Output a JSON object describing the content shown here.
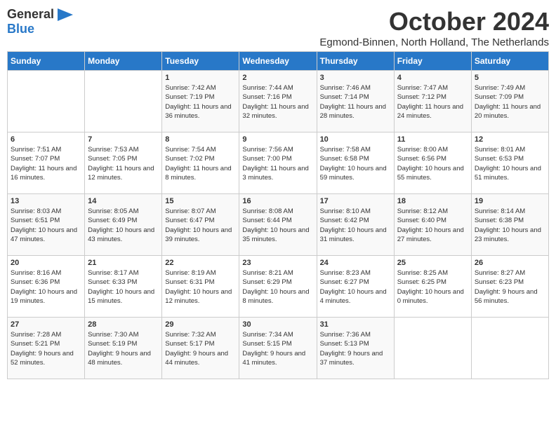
{
  "header": {
    "logo_general": "General",
    "logo_blue": "Blue",
    "month_title": "October 2024",
    "subtitle": "Egmond-Binnen, North Holland, The Netherlands"
  },
  "days_of_week": [
    "Sunday",
    "Monday",
    "Tuesday",
    "Wednesday",
    "Thursday",
    "Friday",
    "Saturday"
  ],
  "weeks": [
    [
      {
        "day": "",
        "sunrise": "",
        "sunset": "",
        "daylight": ""
      },
      {
        "day": "",
        "sunrise": "",
        "sunset": "",
        "daylight": ""
      },
      {
        "day": "1",
        "sunrise": "Sunrise: 7:42 AM",
        "sunset": "Sunset: 7:19 PM",
        "daylight": "Daylight: 11 hours and 36 minutes."
      },
      {
        "day": "2",
        "sunrise": "Sunrise: 7:44 AM",
        "sunset": "Sunset: 7:16 PM",
        "daylight": "Daylight: 11 hours and 32 minutes."
      },
      {
        "day": "3",
        "sunrise": "Sunrise: 7:46 AM",
        "sunset": "Sunset: 7:14 PM",
        "daylight": "Daylight: 11 hours and 28 minutes."
      },
      {
        "day": "4",
        "sunrise": "Sunrise: 7:47 AM",
        "sunset": "Sunset: 7:12 PM",
        "daylight": "Daylight: 11 hours and 24 minutes."
      },
      {
        "day": "5",
        "sunrise": "Sunrise: 7:49 AM",
        "sunset": "Sunset: 7:09 PM",
        "daylight": "Daylight: 11 hours and 20 minutes."
      }
    ],
    [
      {
        "day": "6",
        "sunrise": "Sunrise: 7:51 AM",
        "sunset": "Sunset: 7:07 PM",
        "daylight": "Daylight: 11 hours and 16 minutes."
      },
      {
        "day": "7",
        "sunrise": "Sunrise: 7:53 AM",
        "sunset": "Sunset: 7:05 PM",
        "daylight": "Daylight: 11 hours and 12 minutes."
      },
      {
        "day": "8",
        "sunrise": "Sunrise: 7:54 AM",
        "sunset": "Sunset: 7:02 PM",
        "daylight": "Daylight: 11 hours and 8 minutes."
      },
      {
        "day": "9",
        "sunrise": "Sunrise: 7:56 AM",
        "sunset": "Sunset: 7:00 PM",
        "daylight": "Daylight: 11 hours and 3 minutes."
      },
      {
        "day": "10",
        "sunrise": "Sunrise: 7:58 AM",
        "sunset": "Sunset: 6:58 PM",
        "daylight": "Daylight: 10 hours and 59 minutes."
      },
      {
        "day": "11",
        "sunrise": "Sunrise: 8:00 AM",
        "sunset": "Sunset: 6:56 PM",
        "daylight": "Daylight: 10 hours and 55 minutes."
      },
      {
        "day": "12",
        "sunrise": "Sunrise: 8:01 AM",
        "sunset": "Sunset: 6:53 PM",
        "daylight": "Daylight: 10 hours and 51 minutes."
      }
    ],
    [
      {
        "day": "13",
        "sunrise": "Sunrise: 8:03 AM",
        "sunset": "Sunset: 6:51 PM",
        "daylight": "Daylight: 10 hours and 47 minutes."
      },
      {
        "day": "14",
        "sunrise": "Sunrise: 8:05 AM",
        "sunset": "Sunset: 6:49 PM",
        "daylight": "Daylight: 10 hours and 43 minutes."
      },
      {
        "day": "15",
        "sunrise": "Sunrise: 8:07 AM",
        "sunset": "Sunset: 6:47 PM",
        "daylight": "Daylight: 10 hours and 39 minutes."
      },
      {
        "day": "16",
        "sunrise": "Sunrise: 8:08 AM",
        "sunset": "Sunset: 6:44 PM",
        "daylight": "Daylight: 10 hours and 35 minutes."
      },
      {
        "day": "17",
        "sunrise": "Sunrise: 8:10 AM",
        "sunset": "Sunset: 6:42 PM",
        "daylight": "Daylight: 10 hours and 31 minutes."
      },
      {
        "day": "18",
        "sunrise": "Sunrise: 8:12 AM",
        "sunset": "Sunset: 6:40 PM",
        "daylight": "Daylight: 10 hours and 27 minutes."
      },
      {
        "day": "19",
        "sunrise": "Sunrise: 8:14 AM",
        "sunset": "Sunset: 6:38 PM",
        "daylight": "Daylight: 10 hours and 23 minutes."
      }
    ],
    [
      {
        "day": "20",
        "sunrise": "Sunrise: 8:16 AM",
        "sunset": "Sunset: 6:36 PM",
        "daylight": "Daylight: 10 hours and 19 minutes."
      },
      {
        "day": "21",
        "sunrise": "Sunrise: 8:17 AM",
        "sunset": "Sunset: 6:33 PM",
        "daylight": "Daylight: 10 hours and 15 minutes."
      },
      {
        "day": "22",
        "sunrise": "Sunrise: 8:19 AM",
        "sunset": "Sunset: 6:31 PM",
        "daylight": "Daylight: 10 hours and 12 minutes."
      },
      {
        "day": "23",
        "sunrise": "Sunrise: 8:21 AM",
        "sunset": "Sunset: 6:29 PM",
        "daylight": "Daylight: 10 hours and 8 minutes."
      },
      {
        "day": "24",
        "sunrise": "Sunrise: 8:23 AM",
        "sunset": "Sunset: 6:27 PM",
        "daylight": "Daylight: 10 hours and 4 minutes."
      },
      {
        "day": "25",
        "sunrise": "Sunrise: 8:25 AM",
        "sunset": "Sunset: 6:25 PM",
        "daylight": "Daylight: 10 hours and 0 minutes."
      },
      {
        "day": "26",
        "sunrise": "Sunrise: 8:27 AM",
        "sunset": "Sunset: 6:23 PM",
        "daylight": "Daylight: 9 hours and 56 minutes."
      }
    ],
    [
      {
        "day": "27",
        "sunrise": "Sunrise: 7:28 AM",
        "sunset": "Sunset: 5:21 PM",
        "daylight": "Daylight: 9 hours and 52 minutes."
      },
      {
        "day": "28",
        "sunrise": "Sunrise: 7:30 AM",
        "sunset": "Sunset: 5:19 PM",
        "daylight": "Daylight: 9 hours and 48 minutes."
      },
      {
        "day": "29",
        "sunrise": "Sunrise: 7:32 AM",
        "sunset": "Sunset: 5:17 PM",
        "daylight": "Daylight: 9 hours and 44 minutes."
      },
      {
        "day": "30",
        "sunrise": "Sunrise: 7:34 AM",
        "sunset": "Sunset: 5:15 PM",
        "daylight": "Daylight: 9 hours and 41 minutes."
      },
      {
        "day": "31",
        "sunrise": "Sunrise: 7:36 AM",
        "sunset": "Sunset: 5:13 PM",
        "daylight": "Daylight: 9 hours and 37 minutes."
      },
      {
        "day": "",
        "sunrise": "",
        "sunset": "",
        "daylight": ""
      },
      {
        "day": "",
        "sunrise": "",
        "sunset": "",
        "daylight": ""
      }
    ]
  ]
}
